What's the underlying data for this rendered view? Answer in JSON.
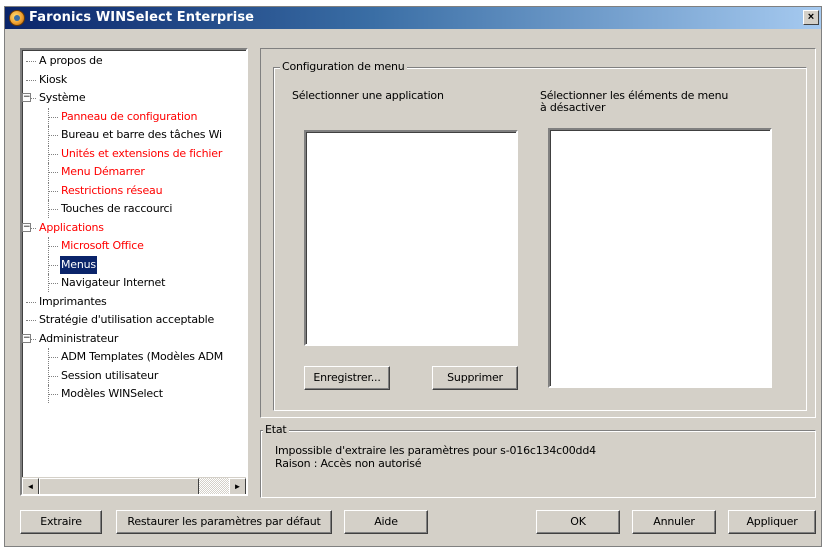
{
  "window": {
    "title": "Faronics WINSelect Enterprise",
    "close_glyph": "×"
  },
  "tree": {
    "items": [
      {
        "label": "A propos de",
        "color": "black"
      },
      {
        "label": "Kiosk",
        "color": "black"
      },
      {
        "label": "Système",
        "color": "black",
        "expander": "−"
      },
      {
        "label": "Panneau de configuration",
        "color": "red"
      },
      {
        "label": "Bureau et barre des tâches Wi",
        "color": "black"
      },
      {
        "label": "Unités et extensions de fichier",
        "color": "red"
      },
      {
        "label": "Menu Démarrer",
        "color": "red"
      },
      {
        "label": "Restrictions réseau",
        "color": "red"
      },
      {
        "label": "Touches de raccourci",
        "color": "black"
      },
      {
        "label": "Applications",
        "color": "red",
        "expander": "−"
      },
      {
        "label": "Microsoft Office",
        "color": "red"
      },
      {
        "label": "Menus",
        "color": "black",
        "selected": true
      },
      {
        "label": "Navigateur Internet",
        "color": "black"
      },
      {
        "label": "Imprimantes",
        "color": "black"
      },
      {
        "label": "Stratégie d'utilisation acceptable",
        "color": "black"
      },
      {
        "label": "Administrateur",
        "color": "black",
        "expander": "−"
      },
      {
        "label": "ADM Templates (Modèles ADM",
        "color": "black"
      },
      {
        "label": "Session utilisateur",
        "color": "black"
      },
      {
        "label": "Modèles WINSelect",
        "color": "black"
      }
    ],
    "scroll_left": "◄",
    "scroll_right": "►"
  },
  "menu_config": {
    "title": "Configuration de menu",
    "select_app_label": "Sélectionner une application",
    "select_items_label_line1": "Sélectionner les éléments de menu",
    "select_items_label_line2": "à désactiver",
    "save_button": "Enregistrer...",
    "delete_button": "Supprimer"
  },
  "status": {
    "title": "Etat",
    "line1": "Impossible d'extraire les paramètres pour s-016c134c00dd4",
    "line2": "Raison : Accès non autorisé"
  },
  "buttons": {
    "extract": "Extraire",
    "restore_defaults": "Restaurer les paramètres par défaut",
    "help": "Aide",
    "ok": "OK",
    "cancel": "Annuler",
    "apply": "Appliquer"
  }
}
